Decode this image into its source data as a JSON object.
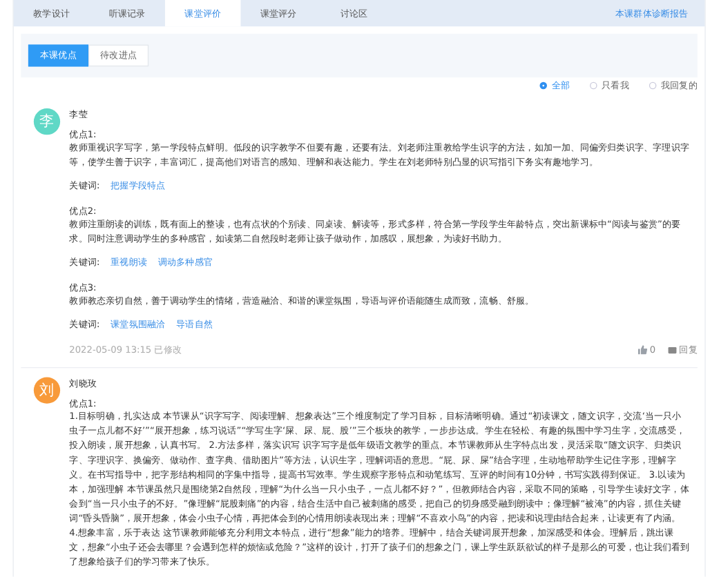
{
  "tabs": [
    {
      "label": "教学设计",
      "selected": false
    },
    {
      "label": "听课记录",
      "selected": false
    },
    {
      "label": "课堂评价",
      "selected": true
    },
    {
      "label": "课堂评分",
      "selected": false
    },
    {
      "label": "讨论区",
      "selected": false
    }
  ],
  "report_link": "本课群体诊断报告",
  "sub_tabs": [
    {
      "label": "本课优点",
      "selected": true
    },
    {
      "label": "待改进点",
      "selected": false
    }
  ],
  "filters": [
    {
      "label": "全部",
      "selected": true
    },
    {
      "label": "只看我",
      "selected": false
    },
    {
      "label": "我回复的",
      "selected": false
    }
  ],
  "comments": [
    {
      "avatar": "李",
      "color": "#5fd8c6",
      "author": "李莹",
      "points": [
        {
          "title": "优点1:",
          "text": "教师重视识字写字，第一学段特点鲜明。低段的识字教学不但要有趣，还要有法。刘老师注重教给学生识字的方法，如加一加、同偏旁归类识字、字理识字等，使学生善于识字，丰富词汇，提高他们对语言的感知、理解和表达能力。学生在刘老师特别凸显的识写指引下务实有趣地学习。",
          "keywords_label": "关键词:",
          "keywords": [
            "把握学段特点"
          ]
        },
        {
          "title": "优点2:",
          "text": "教师注重朗读的训练，既有面上的整读，也有点状的个别读、同桌读、解读等，形式多样，符合第一学段学生年龄特点，突出新课标中“阅读与鉴赏”的要求。同时注意调动学生的多种感官，如读第二自然段时老师让孩子做动作，加感叹，展想象，为读好书助力。",
          "keywords_label": "关键词:",
          "keywords": [
            "重视朗读",
            "调动多种感官"
          ]
        },
        {
          "title": "优点3:",
          "text": "教师教态亲切自然，善于调动学生的情绪，营造融洽、和谐的课堂氛围，导语与评价语能随生成而致，流畅、舒服。",
          "keywords_label": "关键词:",
          "keywords": [
            "课堂氛围融洽",
            "导语自然"
          ]
        }
      ],
      "timestamp": "2022-05-09 13:15 已修改",
      "likes": "0",
      "reply": "回复"
    },
    {
      "avatar": "刘",
      "color": "#f89a3a",
      "author": "刘晓玫",
      "points": [
        {
          "title": "优点1:",
          "text": "1.目标明确，扎实达成 本节课从“识字写字、阅读理解、想象表达”三个维度制定了学习目标，目标清晰明确。通过“初读课文，随文识字，交流‘当一只小虫子一点儿都不好’”“展开想象，练习说话”“学写生字‘屎、尿、屁、股’”三个板块的教学，一步步达成。学生在轻松、有趣的氛围中学习生字，交流感受，投入朗读，展开想象，认真书写。 2.方法多样，落实识写 识字写字是低年级语文教学的重点。本节课教师从生字特点出发，灵活采取“随文识字、归类识字、字理识字、换偏旁、做动作、查字典、借助图片”等方法，认识生字，理解词语的意思。“屁、尿、屎”结合字理，生动地帮助学生记住字形，理解字义。在书写指导中，把字形结构相同的字集中指导，提高书写效率。学生观察字形特点和动笔练写、互评的时间有10分钟，书写实践得到保证。 3.以读为本，加强理解 本节课虽然只是围绕第2自然段，理解“为什么当一只小虫子，一点儿都不好？”，但教师结合内容，采取不同的策略，引导学生读好文字，体会到“当一只小虫子的不好。”像理解“屁股刺痛”的内容，结合生活中自己被刺痛的感受，把自己的切身感受融到朗读中；像理解“被淹”的内容，抓住关键词“昏头昏脑”，展开想象，体会小虫子心情，再把体会到的心情用朗读表现出来；理解“不喜欢小鸟”的内容，把读和说理由结合起来，让读更有了内涵。 4.想象丰富，乐于表达 这节课教师能够充分利用文本特点，进行“想象”能力的培养。理解中，结合关键词展开想象，加深感受和体会。理解后，跳出课文，想象“小虫子还会去哪里？会遇到怎样的烦恼或危险？”这样的设计，打开了孩子们的想象之门，课上学生跃跃欲试的样子是那么的可爱，也让我们看到了想象给孩子们的学习带来了快乐。"
        }
      ]
    }
  ]
}
